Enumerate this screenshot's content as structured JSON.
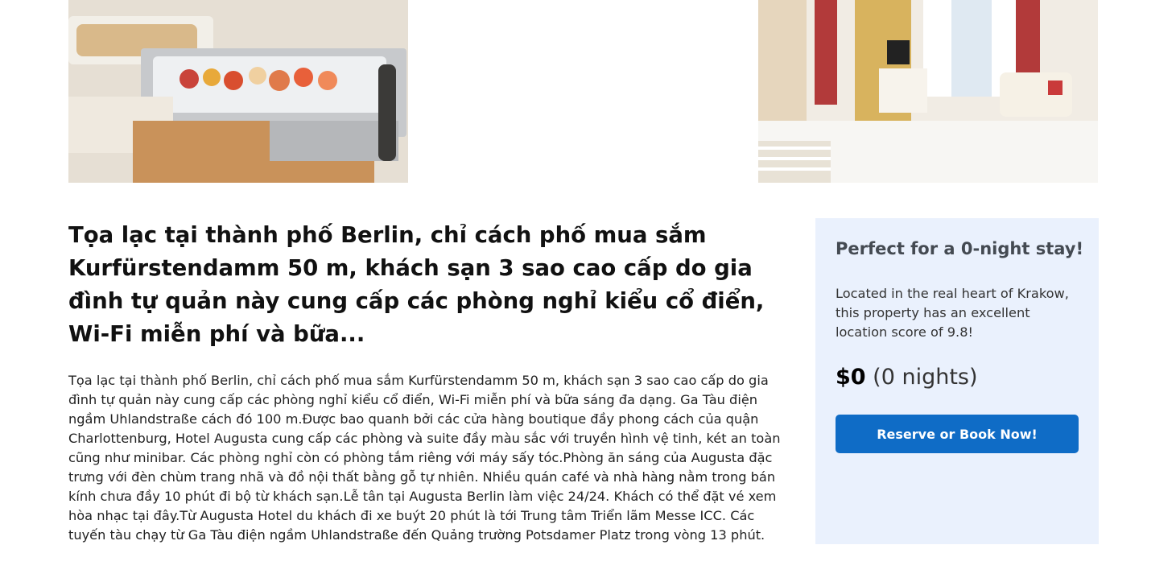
{
  "gallery": {
    "left_image_alt": "breakfast buffet photo",
    "right_image_alt": "classic hotel room photo"
  },
  "main": {
    "headline": "Tọa lạc tại thành phố Berlin, chỉ cách phố mua sắm Kurfürstendamm 50 m, khách sạn 3 sao cao cấp do gia đình tự quản này cung cấp các phòng nghỉ kiểu cổ điển, Wi-Fi miễn phí và bữa...",
    "description": "Tọa lạc tại thành phố Berlin, chỉ cách phố mua sắm Kurfürstendamm 50 m, khách sạn 3 sao cao cấp do gia đình tự quản này cung cấp các phòng nghỉ kiểu cổ điển, Wi-Fi miễn phí và bữa sáng đa dạng. Ga Tàu điện ngầm Uhlandstraße cách đó 100 m.Được bao quanh bởi các cửa hàng boutique đầy phong cách của quận Charlottenburg, Hotel Augusta cung cấp các phòng và suite đầy màu sắc với truyền hình vệ tinh, két an toàn cũng như minibar. Các phòng nghỉ còn có phòng tắm riêng với máy sấy tóc.Phòng ăn sáng của Augusta đặc trưng với đèn chùm trang nhã và đồ nội thất bằng gỗ tự nhiên. Nhiều quán café và nhà hàng nằm trong bán kính chưa đầy 10 phút đi bộ từ khách sạn.Lễ tân tại Augusta Berlin làm việc 24/24. Khách có thể đặt vé xem hòa nhạc tại đây.Từ Augusta Hotel du khách đi xe buýt 20 phút là tới Trung tâm Triển lãm Messe ICC. Các tuyến tàu chạy từ Ga Tàu điện ngầm Uhlandstraße đến Quảng trường Potsdamer Platz trong vòng 13 phút."
  },
  "booking": {
    "title": "Perfect for a 0-night stay!",
    "text": "Located in the real heart of Krakow, this property has an excellent location score of 9.8!",
    "price": "$0",
    "nights": "(0 nights)",
    "button_label": "Reserve or Book Now!",
    "colors": {
      "card_bg": "#eaf1fd",
      "button_bg": "#0f6cc6"
    }
  }
}
